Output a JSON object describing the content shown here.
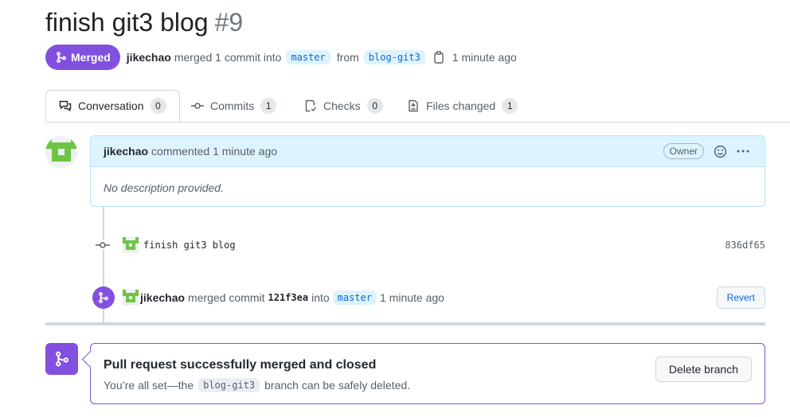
{
  "pr": {
    "title": "finish git3 blog",
    "number": "#9",
    "state_label": "Merged",
    "author": "jikechao",
    "merge_text": "merged 1 commit into",
    "base_branch": "master",
    "from_text": "from",
    "head_branch": "blog-git3",
    "time": "1 minute ago"
  },
  "tabs": [
    {
      "label": "Conversation",
      "count": "0",
      "icon": "comment-discussion-icon"
    },
    {
      "label": "Commits",
      "count": "1",
      "icon": "git-commit-icon"
    },
    {
      "label": "Checks",
      "count": "0",
      "icon": "checklist-icon"
    },
    {
      "label": "Files changed",
      "count": "1",
      "icon": "file-diff-icon"
    }
  ],
  "comment": {
    "author": "jikechao",
    "action": "commented 1 minute ago",
    "role": "Owner",
    "body": "No description provided."
  },
  "commit": {
    "message": "finish git3 blog",
    "sha": "836df65"
  },
  "merge_event": {
    "author": "jikechao",
    "text1": "merged commit",
    "sha": "121f3ea",
    "text2": "into",
    "branch": "master",
    "time": "1 minute ago",
    "revert_label": "Revert"
  },
  "merged_box": {
    "title": "Pull request successfully merged and closed",
    "sub_before": "You’re all set—the",
    "branch": "blog-git3",
    "sub_after": "branch can be safely deleted.",
    "delete_label": "Delete branch"
  },
  "colors": {
    "merged_purple": "#8250df",
    "link_blue": "#0969da",
    "comment_header_bg": "#ddf4ff",
    "avatar_green": "#6cc644"
  }
}
